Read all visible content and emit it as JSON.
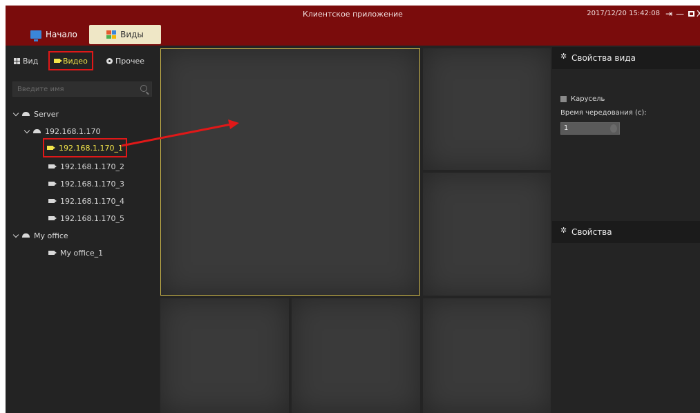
{
  "window": {
    "title": "Клиентское приложение",
    "datetime": "2017/12/20 15:42:08",
    "controls": {
      "logout": "⇥",
      "minimize": "—",
      "close": "X"
    }
  },
  "tabs": [
    {
      "label": "Начало",
      "icon": "monitor-icon",
      "active": false
    },
    {
      "label": "Виды",
      "icon": "grid-icon",
      "active": true
    }
  ],
  "left_panel": {
    "subtabs": [
      {
        "label": "Вид",
        "icon": "grid-small-icon"
      },
      {
        "label": "Видео",
        "icon": "camera-icon",
        "active": true
      },
      {
        "label": "Прочее",
        "icon": "circle-gear-icon"
      }
    ],
    "search": {
      "placeholder": "Введите имя"
    },
    "tree": {
      "server": "Server",
      "host": "192.168.1.170",
      "cameras": [
        "192.168.1.170_1",
        "192.168.1.170_2",
        "192.168.1.170_3",
        "192.168.1.170_4",
        "192.168.1.170_5"
      ],
      "office": "My office",
      "office_cameras": [
        "My office_1"
      ]
    }
  },
  "right_panel": {
    "view_properties": {
      "title": "Свойства вида",
      "carousel_label": "Карусель",
      "interval_label": "Время чередования (с):",
      "interval_value": "1"
    },
    "properties": {
      "title": "Свойства"
    }
  },
  "colors": {
    "titlebar": "#7a0c0c",
    "active_tab": "#efe7c6",
    "highlight": "#e01818",
    "selected_text": "#f2e44a",
    "active_cell_border": "#c9b34a"
  }
}
